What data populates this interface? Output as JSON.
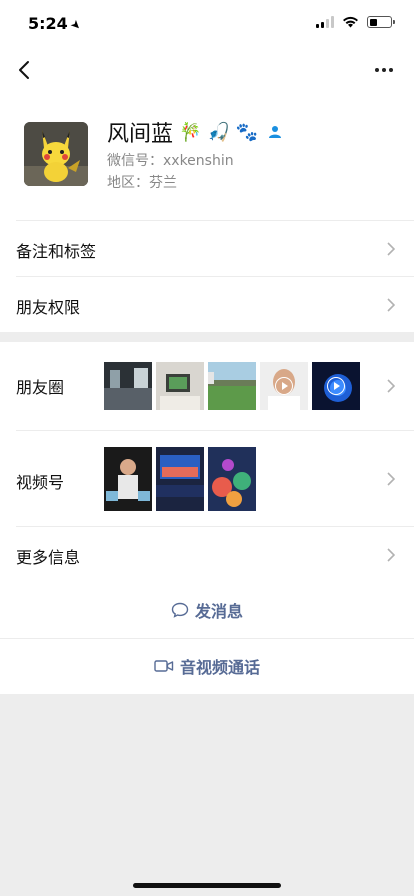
{
  "status_bar": {
    "time": "5:24"
  },
  "profile": {
    "name": "风间蓝",
    "emojis": [
      "🎋",
      "🎣",
      "🐾"
    ],
    "wechat_id": "微信号：xxkenshin",
    "region": "地区：芬兰"
  },
  "rows": {
    "remarks": "备注和标签",
    "permissions": "朋友权限",
    "moments": "朋友圈",
    "channels": "视频号",
    "more_info": "更多信息"
  },
  "actions": {
    "message": "发消息",
    "video_call": "音视频通话"
  },
  "icons": {
    "back": "chevron-left-icon",
    "more": "more-horizontal-icon",
    "gender": "user-icon",
    "chevron": "chevron-right-icon",
    "message": "chat-bubble-icon",
    "video": "video-camera-icon"
  },
  "colors": {
    "link": "#576b95",
    "background": "#ededed",
    "gender_icon": "#1a8fe0"
  }
}
